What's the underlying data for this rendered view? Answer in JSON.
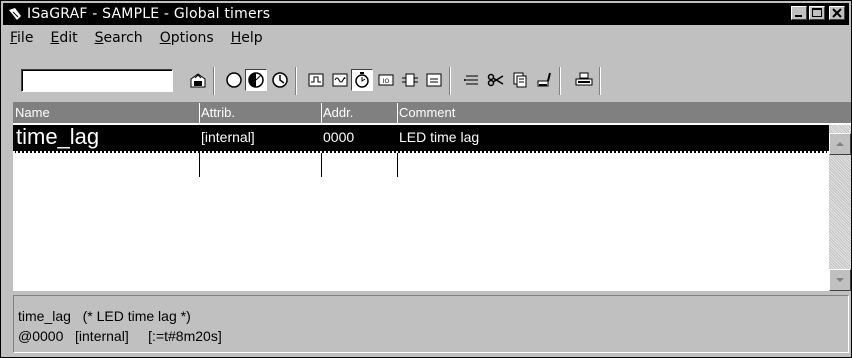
{
  "window": {
    "title": "ISaGRAF - SAMPLE - Global timers",
    "controls": [
      "minimize-icon",
      "maximize-icon",
      "close-icon"
    ]
  },
  "menu": {
    "items": [
      {
        "label": "File",
        "key": "F",
        "rest": "ile"
      },
      {
        "label": "Edit",
        "key": "E",
        "rest": "dit"
      },
      {
        "label": "Search",
        "key": "S",
        "rest": "earch"
      },
      {
        "label": "Options",
        "key": "O",
        "rest": "ptions"
      },
      {
        "label": "Help",
        "key": "H",
        "rest": "elp"
      }
    ]
  },
  "toolbar": {
    "field_value": "",
    "buttons": [
      "store-icon",
      "boolean-circle-icon",
      "analog-half-circle-icon",
      "timer-clock-icon",
      "pulse-icon",
      "wave-icon",
      "timer-dial-icon",
      "io-box-icon",
      "function-block-icon",
      "equals-box-icon",
      "insert-icon",
      "cut-icon",
      "copy-icon",
      "paste-brush-icon",
      "print-icon"
    ]
  },
  "grid": {
    "columns": [
      "Name",
      "Attrib.",
      "Addr.",
      "Comment"
    ],
    "rows": [
      {
        "name": "time_lag",
        "attrib": "[internal]",
        "addr": "0000",
        "comment": "LED time lag",
        "selected": true
      }
    ]
  },
  "status": {
    "line1": "time_lag   (* LED time lag *)",
    "line2": "@0000   [internal]     [:=t#8m20s]"
  }
}
